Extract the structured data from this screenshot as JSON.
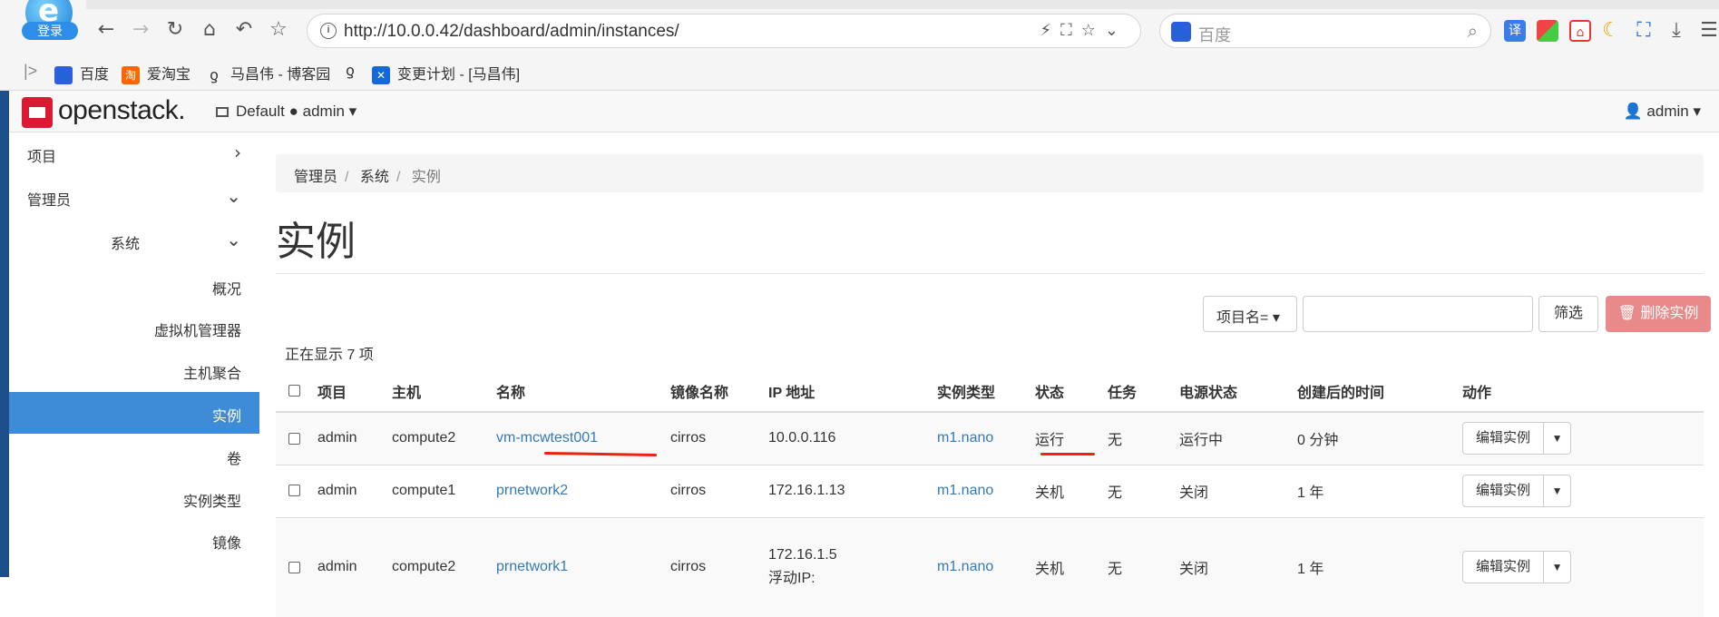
{
  "browser": {
    "login_badge": "登录",
    "url": "http://10.0.0.42/dashboard/admin/instances/",
    "search_placeholder": "百度",
    "ext_translate": "译",
    "bookmarks": [
      {
        "label": "百度",
        "icon": "baidu-paw-icon"
      },
      {
        "label": "爱淘宝",
        "icon": "taobao-icon",
        "icon_text": "淘"
      },
      {
        "label": "马昌伟 - 博客园",
        "icon": "cnblogs-icon"
      },
      {
        "label": "",
        "icon": "cnblogs-icon"
      },
      {
        "label": "变更计划 - [马昌伟]",
        "icon": "confluence-icon"
      }
    ]
  },
  "header": {
    "brand": "openstack.",
    "project_selector": "Default",
    "project_user": "admin",
    "user_menu": "admin"
  },
  "sidebar": {
    "items": [
      {
        "label": "项目"
      },
      {
        "label": "管理员"
      },
      {
        "label": "系统"
      },
      {
        "label": "概况"
      },
      {
        "label": "虚拟机管理器"
      },
      {
        "label": "主机聚合"
      },
      {
        "label": "实例"
      },
      {
        "label": "卷"
      },
      {
        "label": "实例类型"
      },
      {
        "label": "镜像"
      }
    ]
  },
  "main": {
    "breadcrumb": [
      "管理员",
      "系统",
      "实例"
    ],
    "title": "实例",
    "filter_select": "项目名=",
    "filter_value": "",
    "filter_button": "筛选",
    "delete_button": "删除实例",
    "count_text": "正在显示 7 项",
    "columns": [
      "项目",
      "主机",
      "名称",
      "镜像名称",
      "IP 地址",
      "实例类型",
      "状态",
      "任务",
      "电源状态",
      "创建后的时间",
      "动作"
    ],
    "rows": [
      {
        "project": "admin",
        "host": "compute2",
        "name": "vm-mcwtest001",
        "image": "cirros",
        "ip": "10.0.0.116",
        "ip_extra": "",
        "flavor": "m1.nano",
        "status": "运行",
        "task": "无",
        "power": "运行中",
        "age": "0 分钟",
        "action": "编辑实例"
      },
      {
        "project": "admin",
        "host": "compute1",
        "name": "prnetwork2",
        "image": "cirros",
        "ip": "172.16.1.13",
        "ip_extra": "",
        "flavor": "m1.nano",
        "status": "关机",
        "task": "无",
        "power": "关闭",
        "age": "1 年",
        "action": "编辑实例"
      },
      {
        "project": "admin",
        "host": "compute2",
        "name": "prnetwork1",
        "image": "cirros",
        "ip": "172.16.1.5",
        "ip_extra": "浮动IP:",
        "flavor": "m1.nano",
        "status": "关机",
        "task": "无",
        "power": "关闭",
        "age": "1 年",
        "action": "编辑实例"
      }
    ]
  }
}
